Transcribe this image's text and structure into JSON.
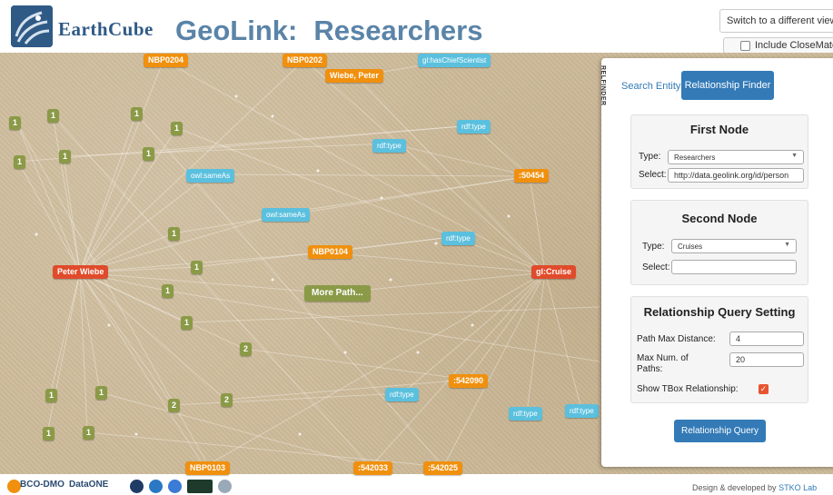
{
  "header": {
    "brand": "EarthCube",
    "app_title": "GeoLink:",
    "page_title": "Researchers",
    "switch_view_label": "Switch to a different view ▾",
    "include_closematch_label": "Include CloseMatch"
  },
  "graph": {
    "nodes": {
      "nbp0204": "NBP0204",
      "nbp0202": "NBP0202",
      "wiebe_peter": "Wiebe, Peter",
      "has_chief_scientist": "gl:hasChiefScientist",
      "rdf_type_1": "rdf:type",
      "rdf_type_2": "rdf:type",
      "s50454": ":50454",
      "owl_sameas_1": "owl:sameAs",
      "owl_sameas_2": "owl:sameAs",
      "rdf_type_3": "rdf:type",
      "nbp0104": "NBP0104",
      "peter_wiebe": "Peter Wiebe",
      "gl_cruise": "gl:Cruise",
      "more_path": "More Path...",
      "s542090": ":542090",
      "rdf_type_4": "rdf:type",
      "rdf_type_5": "rdf:type",
      "rdf_type_6": "rdf:type",
      "nbp0103": "NBP0103",
      "s542033": ":542033",
      "s542025": ":542025",
      "n1": "1",
      "n2": "1",
      "n3": "1",
      "n4": "1",
      "n5": "1",
      "n6": "1",
      "n7": "1",
      "n8": "1",
      "n9": "1",
      "n10": "1",
      "n11": "1",
      "n12": "2",
      "n13": "1",
      "n14": "1",
      "n15": "2",
      "n16": "2",
      "n17": "1",
      "n18": "1"
    }
  },
  "panel": {
    "side_tab": "RELFINDER",
    "tab_search": "Search Entity",
    "tab_relationship": "Relationship Finder",
    "first_node": {
      "title": "First Node",
      "type_label": "Type:",
      "type_value": "Researchers",
      "select_label": "Select:",
      "select_value": "http://data.geolink.org/id/person"
    },
    "second_node": {
      "title": "Second Node",
      "type_label": "Type:",
      "type_value": "Cruises",
      "select_label": "Select:",
      "select_value": ""
    },
    "settings": {
      "title": "Relationship Query Setting",
      "max_distance_label": "Path Max Distance:",
      "max_distance_value": "4",
      "max_paths_label": "Max Num. of Paths:",
      "max_paths_value": "20",
      "tbox_label": "Show TBox Relationship:",
      "tbox_checked": true
    },
    "query_button": "Relationship Query"
  },
  "footer": {
    "bcodmo": "BCO-DMO",
    "dataone": "DataONE",
    "credit_prefix": "Design & developed by",
    "credit_lab": "STKO Lab"
  },
  "colors": {
    "orange_node": "#f0900e",
    "red_node": "#e04b2b",
    "blue_node": "#5bc0de",
    "olive_node": "#8b9a47",
    "primary_button": "#337ab7",
    "title_blue": "#5a84a8"
  }
}
